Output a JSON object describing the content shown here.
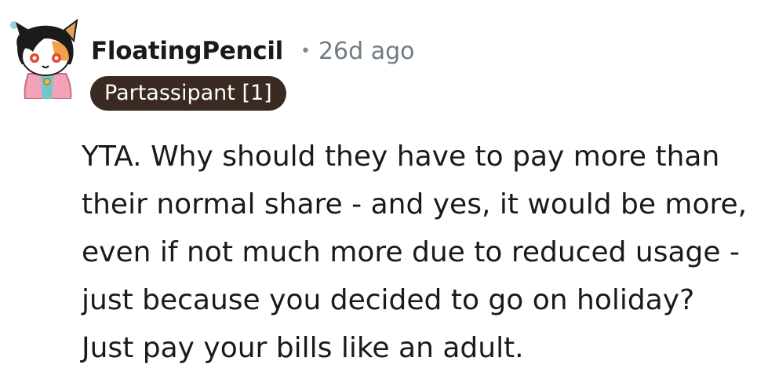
{
  "comment": {
    "username": "FloatingPencil",
    "separator": "•",
    "timestamp": "26d ago",
    "flair": "Partassipant [1]",
    "text": "YTA. Why should they have to pay more than their normal share - and yes, it would be more, even if not much more due to reduced usage - just because you decided to go on holiday? Just pay your bills like an adult."
  },
  "avatar": {
    "icon": "cat-avatar-icon"
  },
  "colors": {
    "flair_bg": "#3a2a22",
    "flair_text": "#ffffff",
    "username": "#1a1a1b",
    "meta": "#6f7c84",
    "body": "#1a1a1b"
  }
}
